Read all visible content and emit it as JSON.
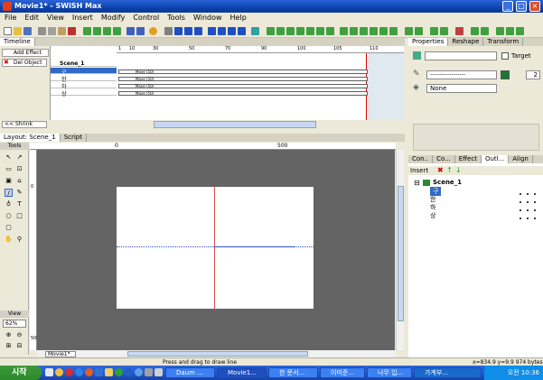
{
  "window": {
    "title": "Movie1* - SWiSH Max",
    "min": "_",
    "max": "□",
    "close": "×"
  },
  "menu": [
    "File",
    "Edit",
    "View",
    "Insert",
    "Modify",
    "Control",
    "Tools",
    "Window",
    "Help"
  ],
  "timeline": {
    "tab": "Timeline",
    "add_effect": "Add Effect",
    "del_object": "Del Object",
    "shrink": "<< Shrink",
    "scene": "Scene_1",
    "layers": [
      "구",
      "한",
      "하",
      "상"
    ],
    "frame_label": "Move (50)",
    "ruler": [
      "1",
      "5",
      "10",
      "15",
      "20",
      "25",
      "30",
      "35",
      "40",
      "45",
      "50",
      "55",
      "60",
      "65",
      "70",
      "75",
      "80",
      "85",
      "90",
      "95",
      "100",
      "105",
      "110",
      "115"
    ]
  },
  "layout": {
    "tabs": [
      "Layout: Scene_1",
      "Script"
    ],
    "tools_label": "Tools",
    "view_label": "View",
    "zoom": "62%",
    "ruler_h": [
      "0",
      "500"
    ],
    "ruler_v": [
      "0",
      "500"
    ],
    "bottom_tab": "Movie1*"
  },
  "properties": {
    "tabs": [
      "Properties",
      "Reshape",
      "Transform"
    ],
    "target_label": "Target",
    "line_style": "------------------",
    "line_width": "2",
    "fill": "None"
  },
  "outline": {
    "tabs": [
      "Con..",
      "Co...",
      "Effect",
      "Outl...",
      "Align"
    ],
    "insert": "Insert",
    "scene": "Scene_1",
    "items": [
      "구",
      "한",
      "하",
      "상"
    ]
  },
  "status": {
    "hint": "Press and drag to draw line",
    "coords": "x=834.9 y=9.9 974 bytes"
  },
  "taskbar": {
    "start": "시작",
    "items": [
      "Daum ...",
      "Movie1...",
      "한 문서...",
      "이미준...",
      "나무 입...",
      "가계부..."
    ],
    "clock": "오전 10:36"
  }
}
